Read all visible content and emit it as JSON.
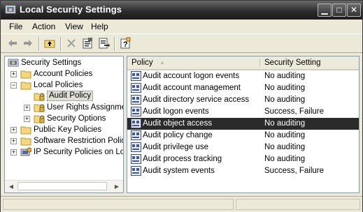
{
  "window": {
    "title": "Local Security Settings"
  },
  "menu": [
    "File",
    "Action",
    "View",
    "Help"
  ],
  "tree": {
    "root": "Security Settings",
    "items": [
      {
        "label": "Account Policies",
        "level": 1,
        "expander": "+",
        "icon": "folder-icon"
      },
      {
        "label": "Local Policies",
        "level": 1,
        "expander": "-",
        "icon": "folder-open-icon"
      },
      {
        "label": "Audit Policy",
        "level": 2,
        "expander": "",
        "icon": "folder-lock-icon",
        "selected": true
      },
      {
        "label": "User Rights Assignmer",
        "level": 2,
        "expander": "+",
        "icon": "folder-lock-icon"
      },
      {
        "label": "Security Options",
        "level": 2,
        "expander": "+",
        "icon": "folder-lock-icon"
      },
      {
        "label": "Public Key Policies",
        "level": 1,
        "expander": "+",
        "icon": "folder-icon"
      },
      {
        "label": "Software Restriction Policie",
        "level": 1,
        "expander": "+",
        "icon": "folder-icon"
      },
      {
        "label": "IP Security Policies on Loca",
        "level": 1,
        "expander": "+",
        "icon": "ip-security-icon"
      }
    ]
  },
  "list": {
    "columns": {
      "policy": "Policy",
      "setting": "Security Setting"
    },
    "rows": [
      {
        "policy": "Audit account logon events",
        "setting": "No auditing"
      },
      {
        "policy": "Audit account management",
        "setting": "No auditing"
      },
      {
        "policy": "Audit directory service access",
        "setting": "No auditing"
      },
      {
        "policy": "Audit logon events",
        "setting": "Success, Failure"
      },
      {
        "policy": "Audit object access",
        "setting": "No auditing",
        "selected": true
      },
      {
        "policy": "Audit policy change",
        "setting": "No auditing"
      },
      {
        "policy": "Audit privilege use",
        "setting": "No auditing"
      },
      {
        "policy": "Audit process tracking",
        "setting": "No auditing"
      },
      {
        "policy": "Audit system events",
        "setting": "Success, Failure"
      }
    ]
  },
  "colors": {
    "titlebar": "#2c2c2c",
    "selection": "#2b2b2b",
    "face": "#ece9d8"
  }
}
